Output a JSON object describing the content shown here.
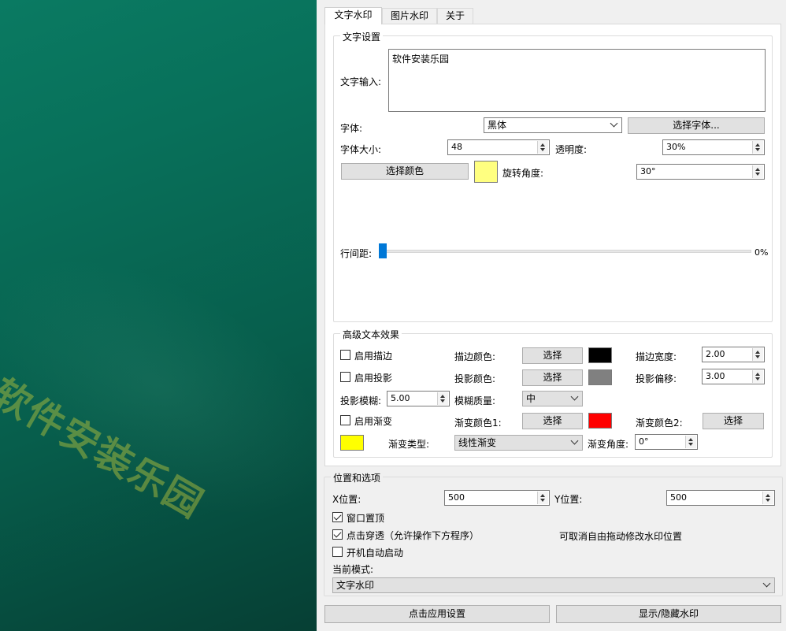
{
  "preview": {
    "watermark_text": "软件安装乐园"
  },
  "tabs": [
    {
      "label": "文字水印",
      "active": true
    },
    {
      "label": "图片水印",
      "active": false
    },
    {
      "label": "关于",
      "active": false
    }
  ],
  "text_settings": {
    "title": "文字设置",
    "text_input_label": "文字输入:",
    "text_input_value": "软件安装乐园",
    "font_label": "字体:",
    "font_value": "黑体",
    "select_font_button": "选择字体...",
    "font_size_label": "字体大小:",
    "font_size_value": "48",
    "opacity_label": "透明度:",
    "opacity_value": "30%",
    "select_color_button": "选择颜色",
    "color_swatch": "#ffff80",
    "rotation_label": "旋转角度:",
    "rotation_value": "30°",
    "line_spacing_label": "行间距:",
    "line_spacing_value": "0%",
    "line_spacing_level": 0
  },
  "advanced": {
    "title": "高级文本效果",
    "enable_stroke": "启用描边",
    "enable_stroke_checked": false,
    "stroke_color_label": "描边颜色:",
    "stroke_color_button": "选择",
    "stroke_color": "#000000",
    "stroke_width_label": "描边宽度:",
    "stroke_width_value": "2.00",
    "enable_shadow": "启用投影",
    "enable_shadow_checked": false,
    "shadow_color_label": "投影颜色:",
    "shadow_color_button": "选择",
    "shadow_color": "#808080",
    "shadow_offset_label": "投影偏移:",
    "shadow_offset_value": "3.00",
    "shadow_blur_label": "投影模糊:",
    "shadow_blur_value": "5.00",
    "blur_quality_label": "模糊质量:",
    "blur_quality_value": "中",
    "enable_gradient": "启用渐变",
    "enable_gradient_checked": false,
    "gradient_color1_label": "渐变颜色1:",
    "gradient_color1_button": "选择",
    "gradient_color1": "#ff0000",
    "gradient_color2_label": "渐变颜色2:",
    "gradient_color2_button": "选择",
    "gradient_color2_swatch": "#ffff00",
    "gradient_type_label": "渐变类型:",
    "gradient_type_value": "线性渐变",
    "gradient_angle_label": "渐变角度:",
    "gradient_angle_value": "0°"
  },
  "position": {
    "title": "位置和选项",
    "x_label": "X位置:",
    "x_value": "500",
    "y_label": "Y位置:",
    "y_value": "500",
    "topmost": "窗口置顶",
    "topmost_checked": true,
    "click_through": "点击穿透（允许操作下方程序）",
    "click_through_checked": true,
    "hint": "可取消自由拖动修改水印位置",
    "autostart": "开机自动启动",
    "autostart_checked": false,
    "mode_label": "当前模式:",
    "mode_value": "文字水印"
  },
  "footer": {
    "apply_button": "点击应用设置",
    "toggle_button": "显示/隐藏水印"
  }
}
